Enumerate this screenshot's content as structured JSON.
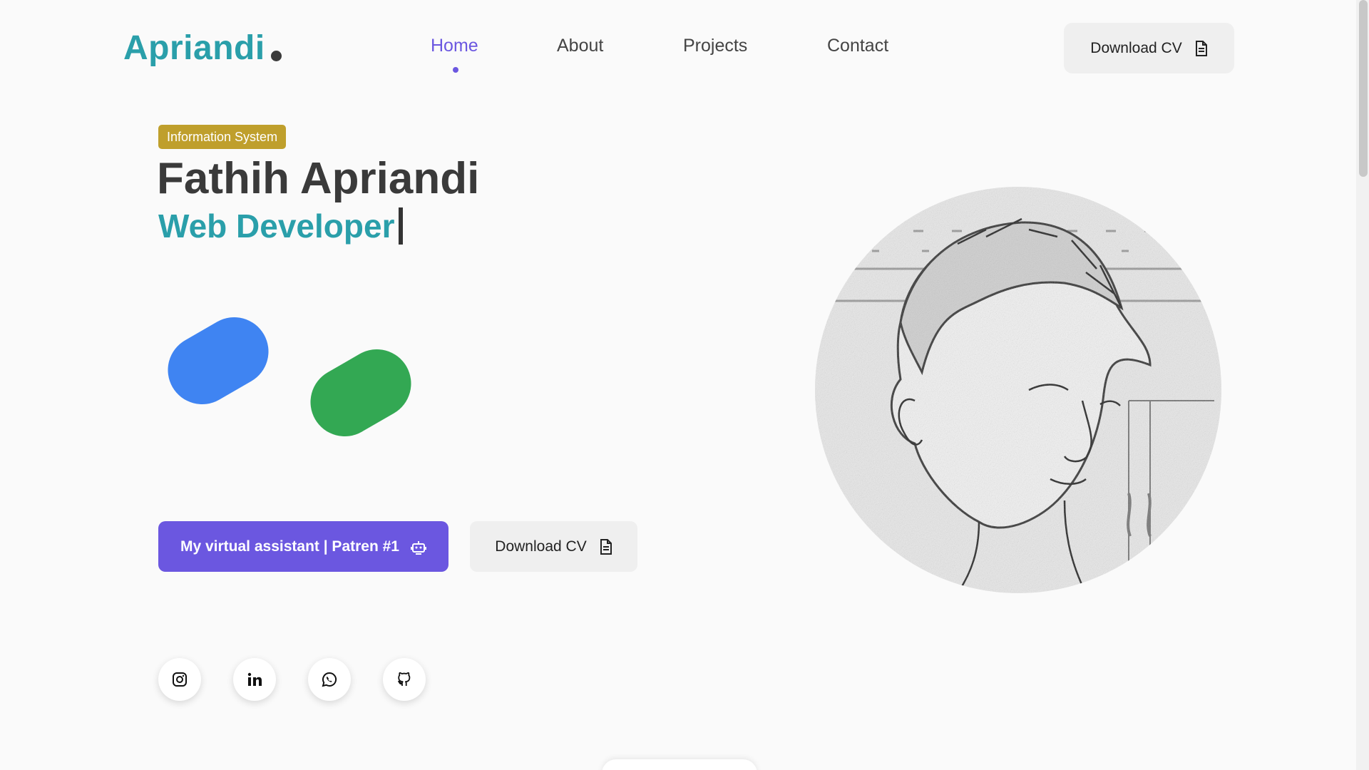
{
  "header": {
    "logo": "Apriandi",
    "nav": [
      {
        "label": "Home",
        "active": true
      },
      {
        "label": "About",
        "active": false
      },
      {
        "label": "Projects",
        "active": false
      },
      {
        "label": "Contact",
        "active": false
      }
    ],
    "download_label": "Download CV"
  },
  "hero": {
    "badge": "Information System",
    "name": "Fathih Apriandi",
    "role": "Web Developer",
    "assistant_button": "My virtual assistant | Patren #1",
    "download_label": "Download CV"
  },
  "social": [
    {
      "icon": "instagram-icon"
    },
    {
      "icon": "linkedin-icon"
    },
    {
      "icon": "whatsapp-icon"
    },
    {
      "icon": "github-icon"
    }
  ],
  "colors": {
    "brand": "#2a9faa",
    "accent": "#6b57e0",
    "badge": "#bf9f2c",
    "pill_blue": "#3f84f2",
    "pill_green": "#33a853"
  }
}
